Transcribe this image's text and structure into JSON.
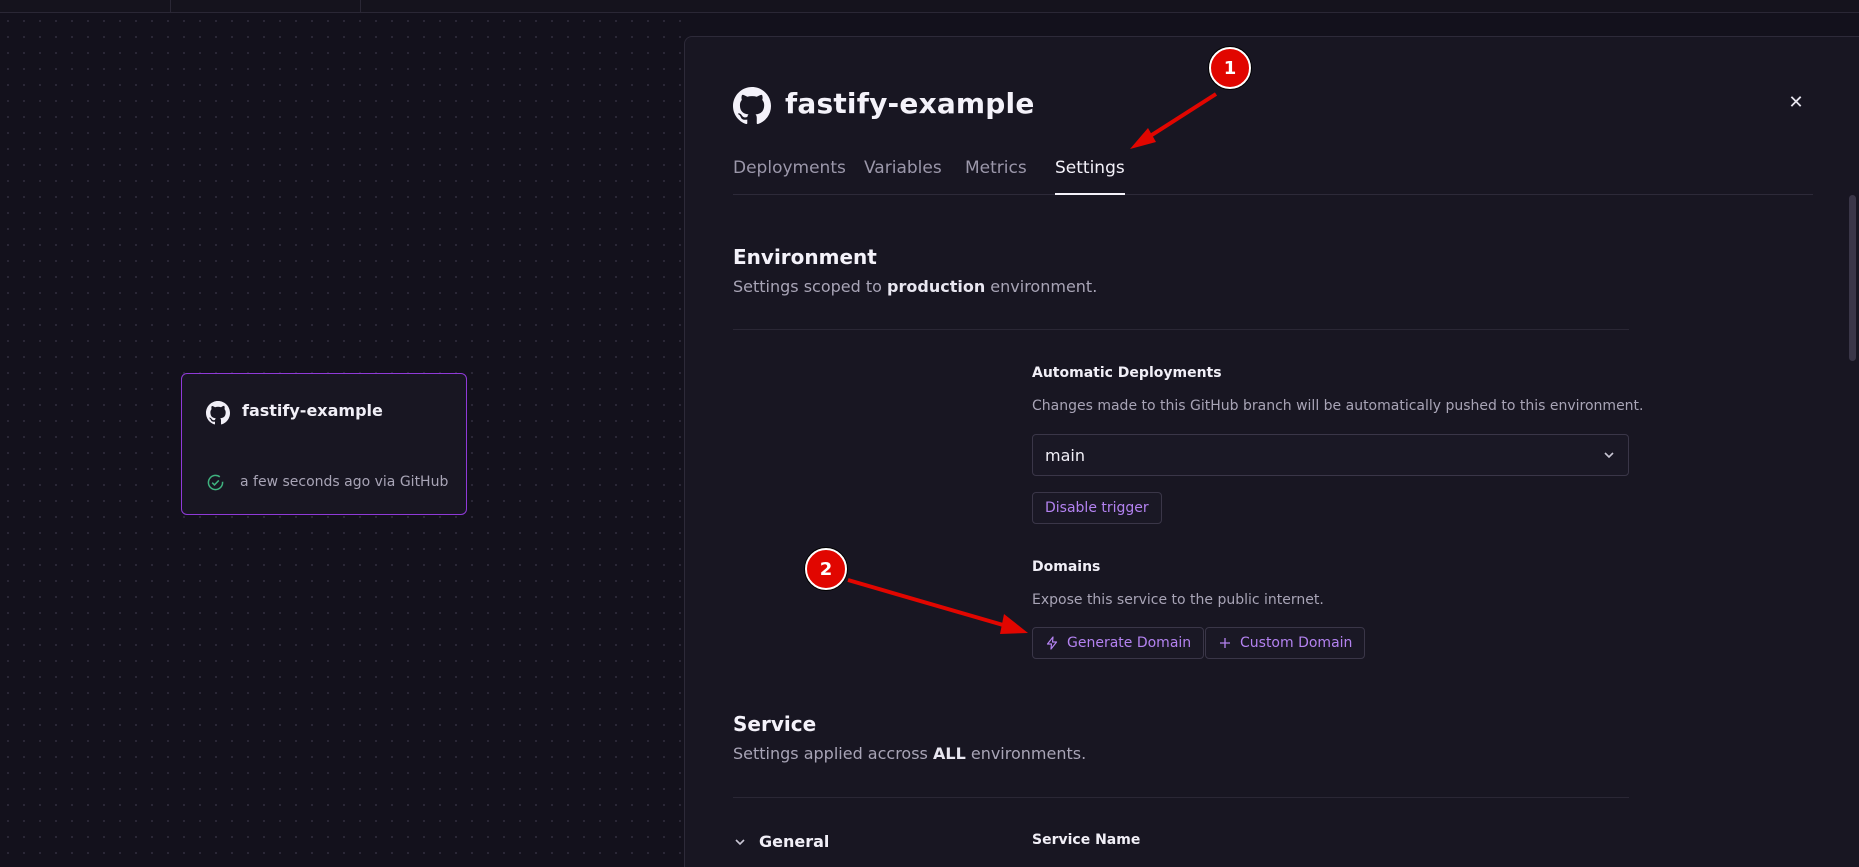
{
  "service_card": {
    "name": "fastify-example",
    "status": "a few seconds ago via GitHub"
  },
  "panel": {
    "title": "fastify-example",
    "close_icon": "close-icon",
    "tabs": [
      {
        "label": "Deployments",
        "active": false
      },
      {
        "label": "Variables",
        "active": false
      },
      {
        "label": "Metrics",
        "active": false
      },
      {
        "label": "Settings",
        "active": true
      }
    ]
  },
  "environment": {
    "title": "Environment",
    "subtitle_before": "Settings scoped to ",
    "subtitle_bold": "production",
    "subtitle_after": " environment.",
    "auto_deploy": {
      "label": "Automatic Deployments",
      "description": "Changes made to this GitHub branch will be automatically pushed to this environment.",
      "branch": "main",
      "disable_button": "Disable trigger"
    },
    "domains": {
      "label": "Domains",
      "description": "Expose this service to the public internet.",
      "generate_button": "Generate Domain",
      "custom_button": "Custom Domain"
    }
  },
  "service": {
    "title": "Service",
    "subtitle_before": "Settings applied accross ",
    "subtitle_bold": "ALL",
    "subtitle_after": " environments.",
    "general_label": "General",
    "service_name_label": "Service Name"
  },
  "annotations": {
    "marker1": "1",
    "marker2": "2"
  },
  "colors": {
    "accent": "#b382f0",
    "card_border": "#8f3ad8",
    "annotation": "#e10600",
    "success": "#3fb27f"
  }
}
